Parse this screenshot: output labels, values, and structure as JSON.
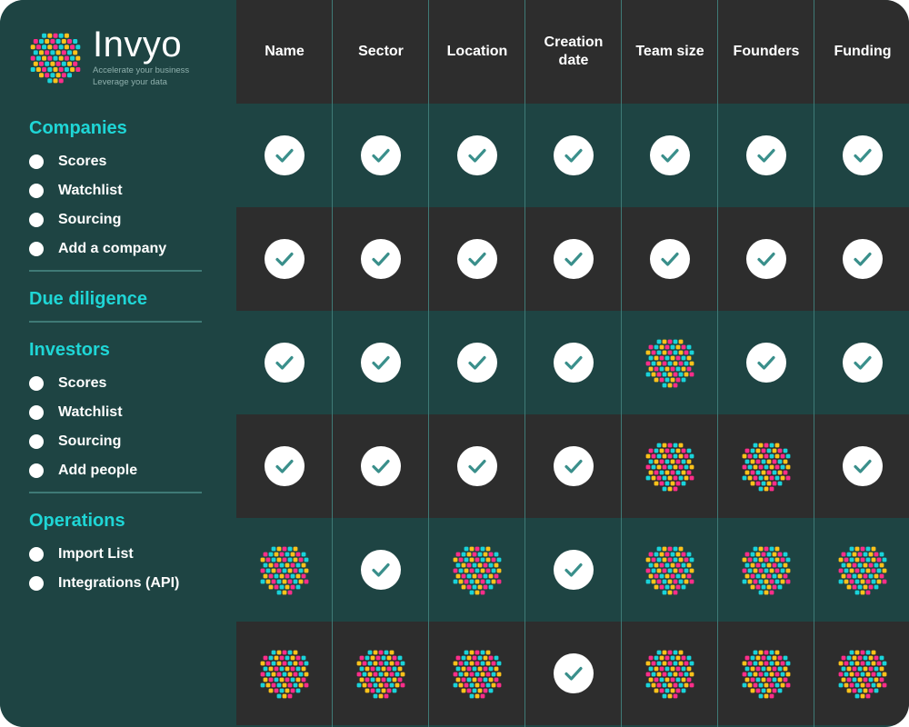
{
  "brand": {
    "name": "Invyo",
    "tagline_1": "Accelerate your business",
    "tagline_2": "Leverage your data",
    "logo_icon": "hexagon-dots-logo"
  },
  "sidebar": {
    "sections": [
      {
        "title": "Companies",
        "items": [
          "Scores",
          "Watchlist",
          "Sourcing",
          "Add a company"
        ]
      },
      {
        "title": "Due diligence",
        "items": []
      },
      {
        "title": "Investors",
        "items": [
          "Scores",
          "Watchlist",
          "Sourcing",
          "Add people"
        ]
      },
      {
        "title": "Operations",
        "items": [
          "Import List",
          "Integrations (API)"
        ]
      }
    ]
  },
  "table": {
    "columns": [
      "Name",
      "Sector",
      "Location",
      "Creation date",
      "Team size",
      "Founders",
      "Funding"
    ],
    "rows": [
      [
        "check",
        "check",
        "check",
        "check",
        "check",
        "check",
        "check"
      ],
      [
        "check",
        "check",
        "check",
        "check",
        "check",
        "check",
        "check"
      ],
      [
        "check",
        "check",
        "check",
        "check",
        "hex",
        "check",
        "check"
      ],
      [
        "check",
        "check",
        "check",
        "check",
        "hex",
        "hex",
        "check"
      ],
      [
        "hex",
        "check",
        "hex",
        "check",
        "hex",
        "hex",
        "hex"
      ],
      [
        "hex",
        "hex",
        "hex",
        "check",
        "hex",
        "hex",
        "hex"
      ]
    ],
    "icons": {
      "check": "check-circle-icon",
      "hex": "hexagon-dots-icon"
    }
  },
  "colors": {
    "sidebar_bg": "#1e4443",
    "row_dark": "#2d2d2d",
    "row_teal": "#1e4443",
    "accent": "#1fd6d6",
    "check": "#3a8f8b",
    "dot_palette": [
      "#ff2d8a",
      "#ffc21a",
      "#19d3da"
    ]
  }
}
